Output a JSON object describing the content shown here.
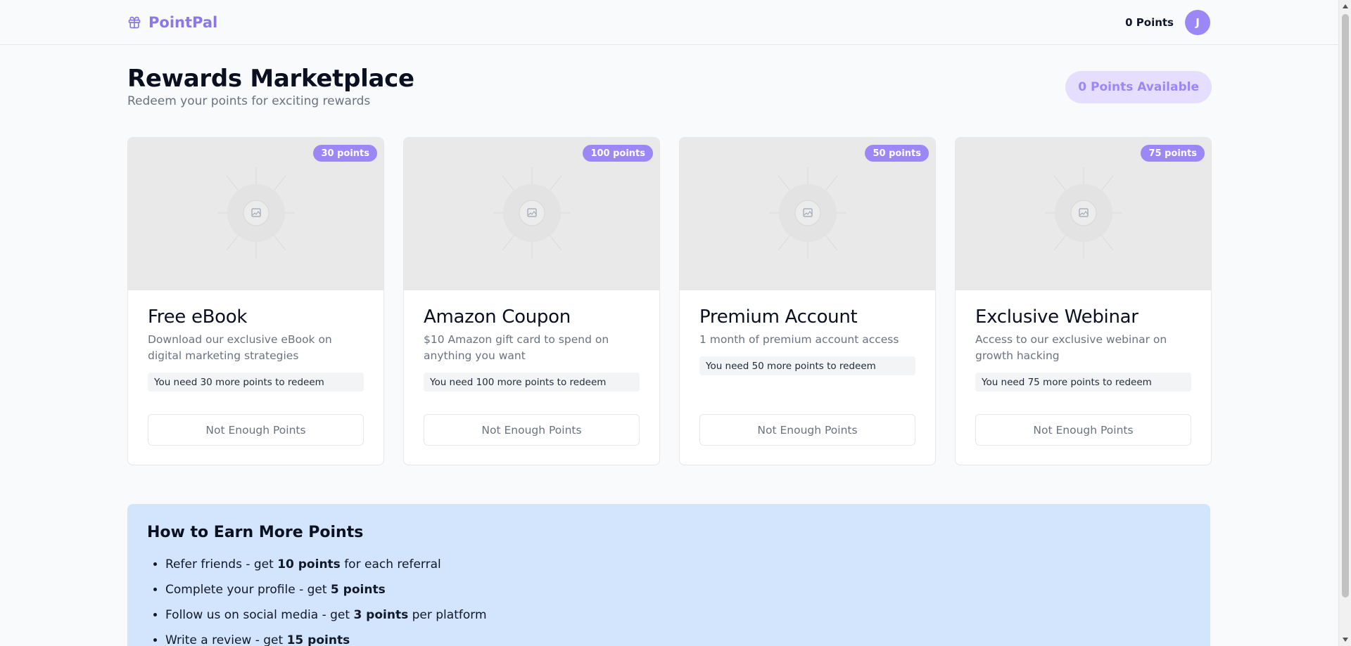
{
  "header": {
    "brand": "PointPal",
    "points": "0 Points",
    "avatar_initial": "J"
  },
  "page": {
    "title": "Rewards Marketplace",
    "subtitle": "Redeem your points for exciting rewards",
    "points_available": "0 Points Available"
  },
  "rewards": [
    {
      "cost": "30 points",
      "title": "Free eBook",
      "description": "Download our exclusive eBook on digital marketing strategies",
      "need": "You need 30 more points to redeem",
      "button": "Not Enough Points"
    },
    {
      "cost": "100 points",
      "title": "Amazon Coupon",
      "description": "$10 Amazon gift card to spend on anything you want",
      "need": "You need 100 more points to redeem",
      "button": "Not Enough Points"
    },
    {
      "cost": "50 points",
      "title": "Premium Account",
      "description": "1 month of premium account access",
      "need": "You need 50 more points to redeem",
      "button": "Not Enough Points"
    },
    {
      "cost": "75 points",
      "title": "Exclusive Webinar",
      "description": "Access to our exclusive webinar on growth hacking",
      "need": "You need 75 more points to redeem",
      "button": "Not Enough Points"
    }
  ],
  "earn": {
    "title": "How to Earn More Points",
    "items": [
      {
        "pre": "Refer friends - get ",
        "bold": "10 points",
        "post": " for each referral"
      },
      {
        "pre": "Complete your profile - get ",
        "bold": "5 points",
        "post": ""
      },
      {
        "pre": "Follow us on social media - get ",
        "bold": "3 points",
        "post": " per platform"
      },
      {
        "pre": "Write a review - get ",
        "bold": "15 points",
        "post": ""
      }
    ]
  },
  "icons": {
    "brand": "gift-icon",
    "image": "image-placeholder-icon"
  },
  "colors": {
    "accent": "#9b87f5",
    "accent_soft": "#e5deff",
    "info_panel": "#d3e4fd",
    "image_bg": "#e9e9e9"
  }
}
